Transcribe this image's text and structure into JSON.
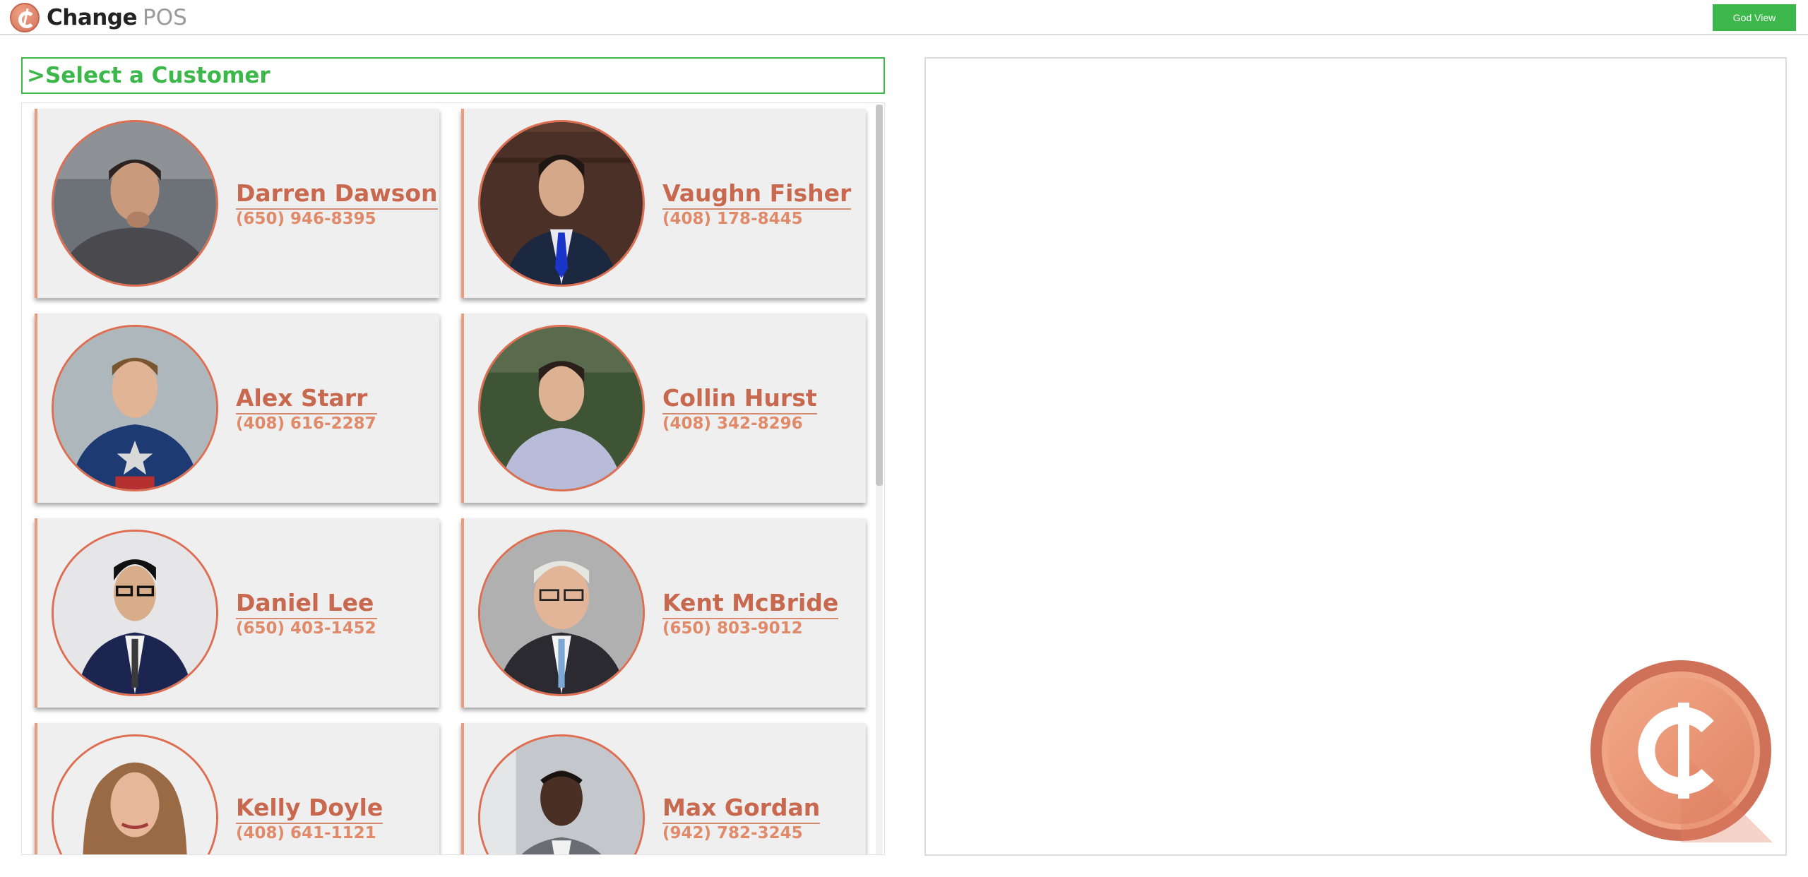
{
  "app": {
    "name": "Change",
    "name_suffix": "POS"
  },
  "header": {
    "god_view_label": "God View"
  },
  "customer_list": {
    "title": ">Select a Customer",
    "customers": [
      {
        "name": "Darren Dawson",
        "phone": "(650) 946-8395",
        "photo": "man-dark-hair-gray-tshirt"
      },
      {
        "name": "Vaughn Fisher",
        "phone": "(408) 178-8445",
        "photo": "man-suit-blue-tie"
      },
      {
        "name": "Alex Starr",
        "phone": "(408) 616-2287",
        "photo": "man-blue-star-costume"
      },
      {
        "name": "Collin Hurst",
        "phone": "(408) 342-8296",
        "photo": "man-light-shirt-hedge"
      },
      {
        "name": "Daniel Lee",
        "phone": "(650) 403-1452",
        "photo": "man-glasses-navy-suit"
      },
      {
        "name": "Kent McBride",
        "phone": "(650) 803-9012",
        "photo": "man-white-hair-glasses"
      },
      {
        "name": "Kelly Doyle",
        "phone": "(408) 641-1121",
        "photo": "woman-brown-hair"
      },
      {
        "name": "Max Gordan",
        "phone": "(942) 782-3245",
        "photo": "man-gray-suit"
      }
    ]
  },
  "colors": {
    "accent_green": "#3cb84a",
    "accent_orange": "#dd6e52",
    "name_text": "#c8694f",
    "card_bg": "#efefef"
  },
  "icons": {
    "brand": "change-cent-logo",
    "watermark": "change-cent-logo-large"
  }
}
